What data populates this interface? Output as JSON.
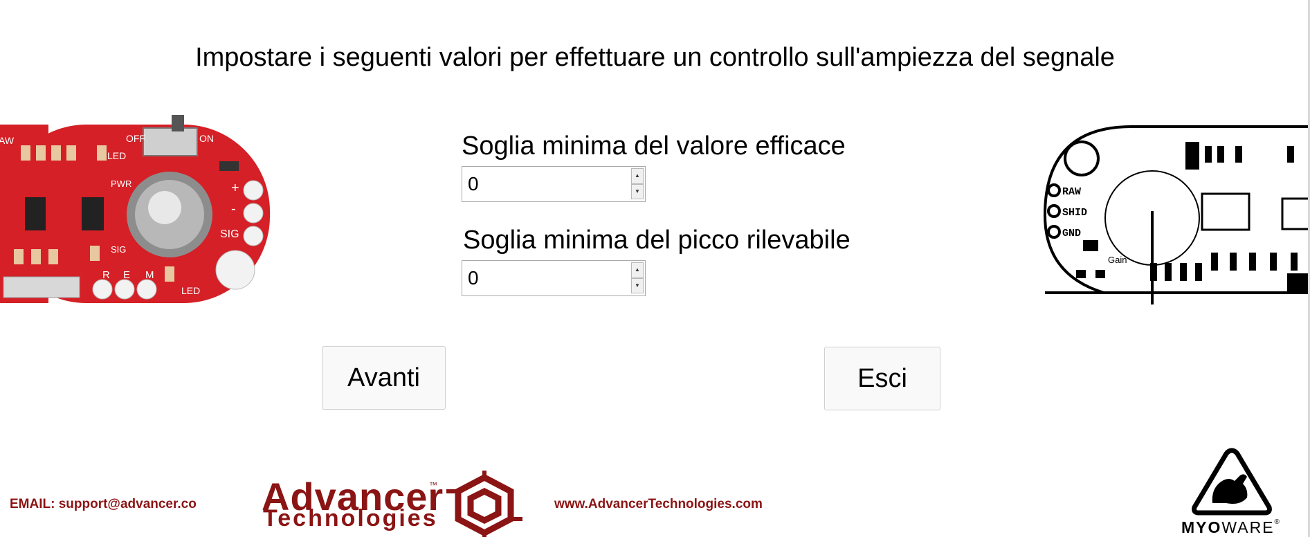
{
  "header": {
    "title": "Impostare i seguenti valori per effettuare un controllo sull'ampiezza del segnale"
  },
  "fields": {
    "rms_threshold": {
      "label": "Soglia minima del valore efficace",
      "value": "0"
    },
    "peak_threshold": {
      "label": "Soglia minima del picco rilevabile",
      "value": "0"
    }
  },
  "buttons": {
    "next_label": "Avanti",
    "exit_label": "Esci"
  },
  "board_left": {
    "labels": [
      "OFF",
      "ON",
      "LED",
      "PWR",
      "SIG",
      "+",
      "-",
      "SIG",
      "R",
      "E",
      "M",
      "LED",
      "AW"
    ]
  },
  "board_right": {
    "labels": [
      "RAW",
      "SHID",
      "GND",
      "Gain"
    ]
  },
  "footer": {
    "email": "EMAIL: support@advancer.co",
    "website": "www.AdvancerTechnologies.com",
    "brand_line1": "Advancer",
    "brand_line2": "Technologies",
    "brand_tm": "™",
    "myoware_bold": "MYO",
    "myoware_rest": "WARE",
    "myoware_reg": "®"
  },
  "colors": {
    "brand_red": "#8b1414",
    "board_red": "#d42026",
    "text": "#000000"
  },
  "icons": {
    "left_board": "myoware-sensor-photo",
    "right_board": "myoware-sensor-diagram",
    "advancer_mark": "hexagonal-logo",
    "myoware_mark": "flexed-arm-triangle"
  }
}
